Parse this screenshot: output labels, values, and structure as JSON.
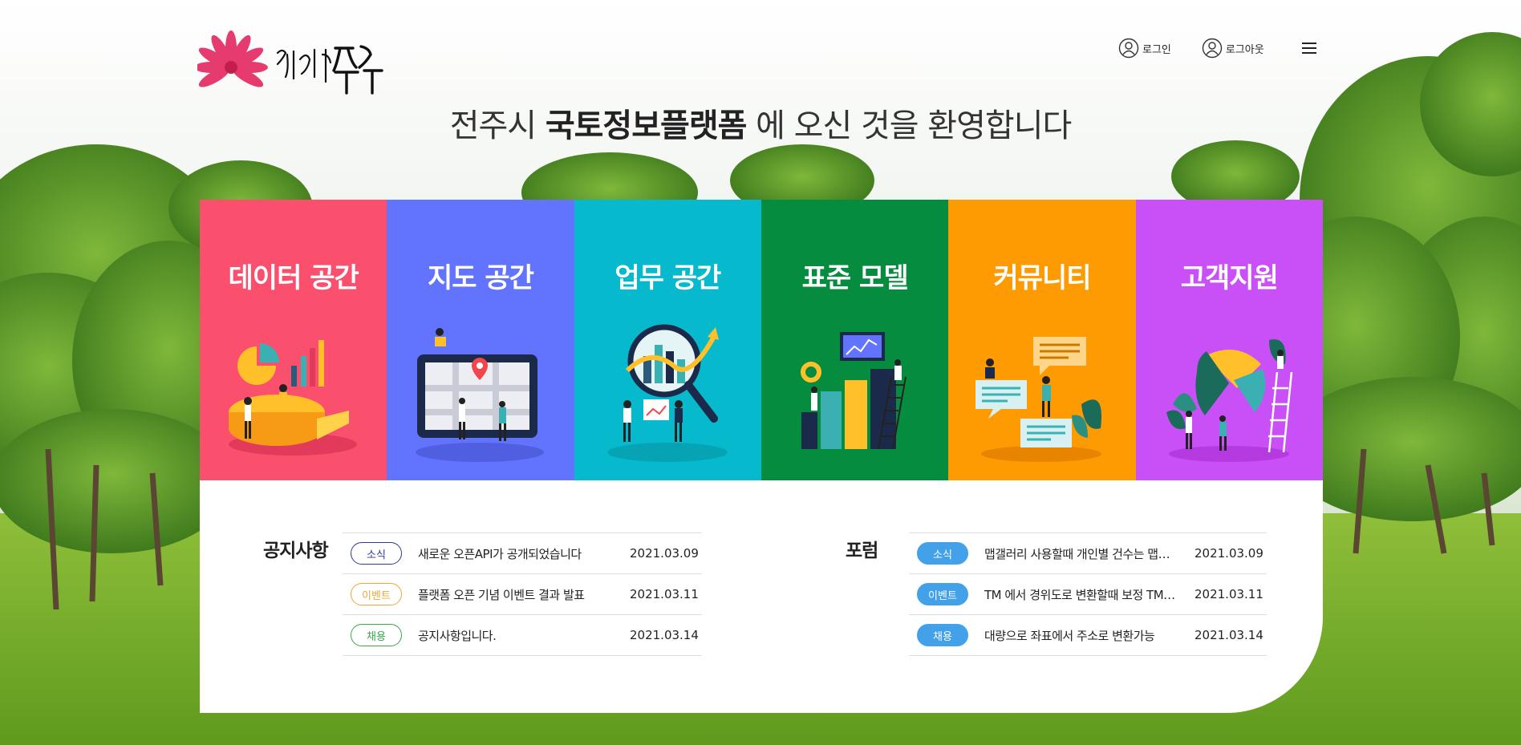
{
  "header": {
    "login_label": "로그인",
    "logout_label": "로그아웃",
    "login_icon": "user-circle-icon",
    "logout_icon": "user-circle-icon",
    "menu_icon": "hamburger-menu-icon",
    "logo_text": "한바탕전주"
  },
  "welcome": {
    "prefix": "전주시 ",
    "highlight": "국토정보플랫폼",
    "suffix": " 에 오신 것을 환영합니다"
  },
  "tiles": [
    {
      "label": "데이터 공간",
      "color": "#fa506e",
      "icon": "data-chart-illustration"
    },
    {
      "label": "지도 공간",
      "color": "#6273fd",
      "icon": "map-illustration"
    },
    {
      "label": "업무 공간",
      "color": "#07b9cc",
      "icon": "analysis-magnifier-illustration"
    },
    {
      "label": "표준 모델",
      "color": "#068c3f",
      "icon": "standard-model-illustration"
    },
    {
      "label": "커뮤니티",
      "color": "#fe9a02",
      "icon": "community-chat-illustration"
    },
    {
      "label": "고객지원",
      "color": "#c950f6",
      "icon": "customer-support-illustration"
    }
  ],
  "notice": {
    "title": "공지사항",
    "items": [
      {
        "tag": "소식",
        "text": "새로운 오픈API가 공개되었습니다",
        "date": "2021.03.09"
      },
      {
        "tag": "이벤트",
        "text": "플랫폼 오픈 기념 이벤트 결과 발표",
        "date": "2021.03.11"
      },
      {
        "tag": "채용",
        "text": "공지사항입니다.",
        "date": "2021.03.14"
      }
    ]
  },
  "forum": {
    "title": "포럼",
    "items": [
      {
        "tag": "소식",
        "text": "맵갤러리 사용할때 개인별 건수는 맵갤러리 사용할때 개인별 건수는",
        "date": "2021.03.09"
      },
      {
        "tag": "이벤트",
        "text": "TM 에서 경위도로 변환할때 보정 TM 에서 경위도로 변환할때 보정",
        "date": "2021.03.11"
      },
      {
        "tag": "채용",
        "text": "대량으로 좌표에서 주소로 변환가능",
        "date": "2021.03.14"
      }
    ]
  }
}
